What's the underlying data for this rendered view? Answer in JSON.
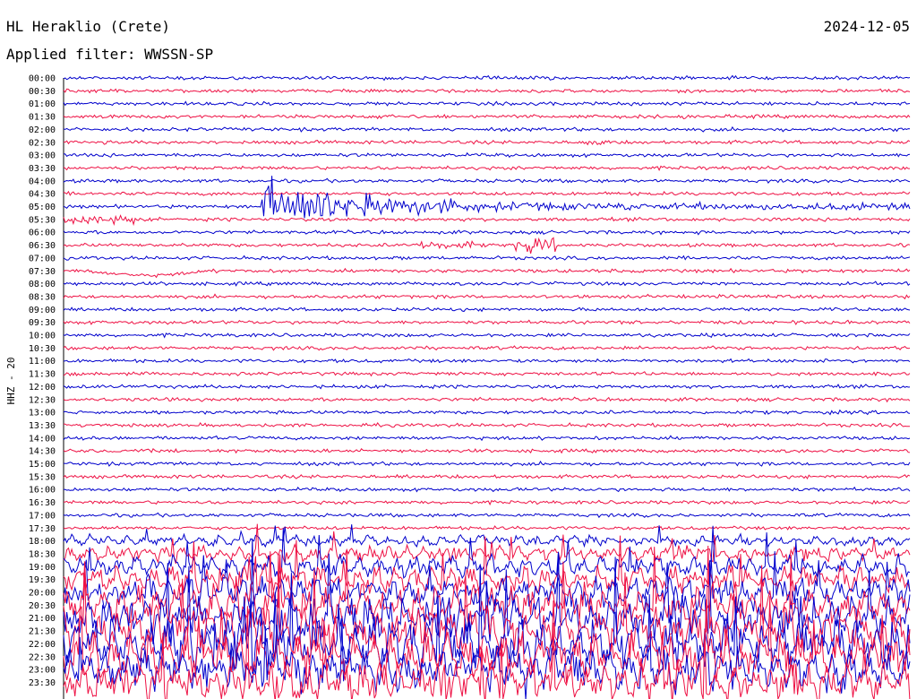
{
  "header": {
    "station": "HL Heraklio (Crete)",
    "date": "2024-12-05",
    "filter": "Applied filter: WWSSN-SP"
  },
  "chart_data": {
    "type": "line",
    "title": "HL Heraklio (Crete)",
    "subtitle": "Applied filter: WWSSN-SP",
    "date": "2024-12-05",
    "ylabel": "HHZ - 20",
    "xlabel": "",
    "time_labels": [
      "00:00",
      "00:30",
      "01:00",
      "01:30",
      "02:00",
      "02:30",
      "03:00",
      "03:30",
      "04:00",
      "04:30",
      "05:00",
      "05:30",
      "06:00",
      "06:30",
      "07:00",
      "07:30",
      "08:00",
      "08:30",
      "09:00",
      "09:30",
      "10:00",
      "10:30",
      "11:00",
      "11:30",
      "12:00",
      "12:30",
      "13:00",
      "13:30",
      "14:00",
      "14:30",
      "15:00",
      "15:30",
      "16:00",
      "16:30",
      "17:00",
      "17:30",
      "18:00",
      "18:30",
      "19:00",
      "19:30",
      "20:00",
      "20:30",
      "21:00",
      "21:30",
      "22:00",
      "22:30",
      "23:00",
      "23:30"
    ],
    "x_range_minutes": [
      0,
      30
    ],
    "trace_colors": [
      "#0000cc",
      "#ee1144"
    ],
    "grid": false,
    "events": [
      {
        "trace": "05:00",
        "start_minute": 7.0,
        "end_minute": 30.0,
        "peak_amplitude": 22,
        "kind": "earthquake"
      },
      {
        "trace": "05:30",
        "start_minute": 0.0,
        "end_minute": 2.5,
        "peak_amplitude": 3,
        "kind": "small"
      },
      {
        "trace": "02:30",
        "start_minute": 18.4,
        "end_minute": 19.2,
        "peak_amplitude": 3,
        "kind": "small"
      },
      {
        "trace": "06:30",
        "start_minute": 12.5,
        "end_minute": 14.5,
        "peak_amplitude": 3,
        "kind": "small"
      },
      {
        "trace": "06:30",
        "start_minute": 16.0,
        "end_minute": 17.5,
        "peak_amplitude": 5,
        "kind": "small"
      },
      {
        "trace": "07:30",
        "start_minute": 0.8,
        "end_minute": 5.0,
        "peak_amplitude": 5,
        "kind": "drift"
      }
    ],
    "noise_onset_trace": "18:00",
    "colors": {
      "trace_a": "#0000cc",
      "trace_b": "#ee1144",
      "text": "#000000"
    }
  }
}
